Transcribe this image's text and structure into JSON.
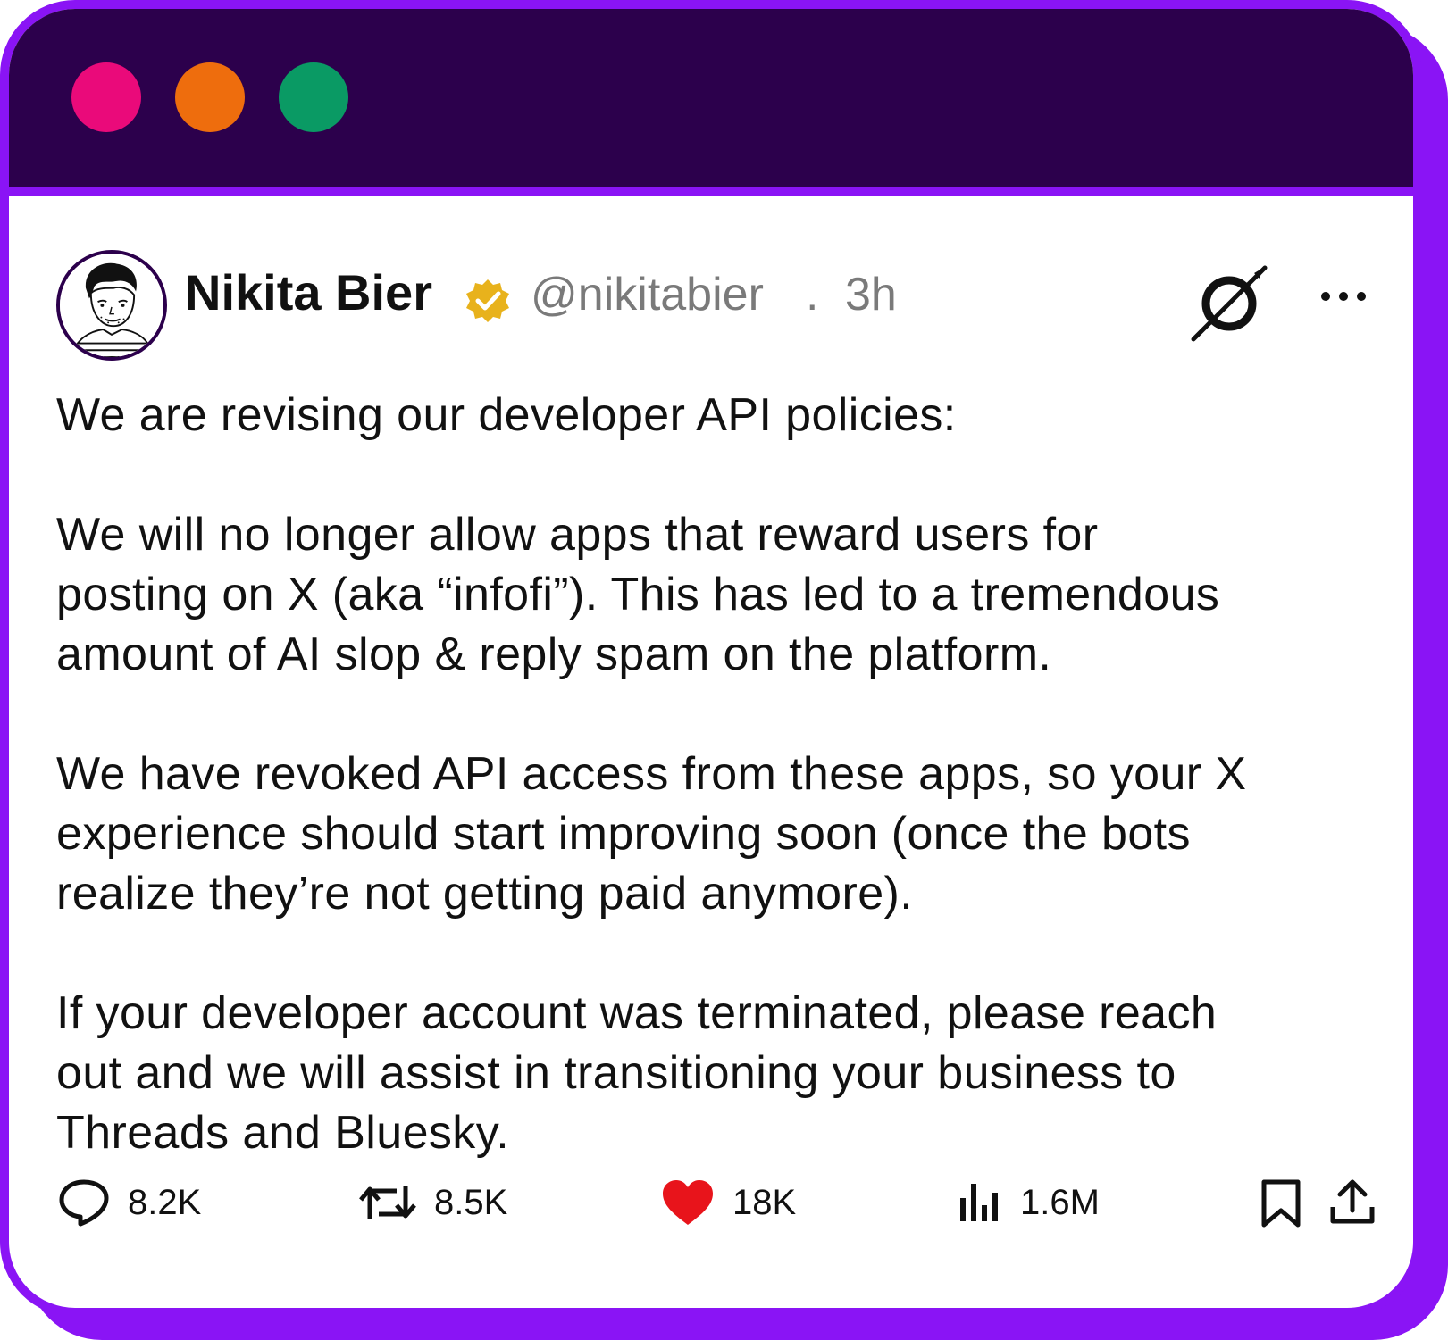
{
  "window": {
    "dots": [
      {
        "name": "close",
        "color": "#ea0a7a"
      },
      {
        "name": "minimize",
        "color": "#ee6d0d"
      },
      {
        "name": "maximize",
        "color": "#0a9a64"
      }
    ],
    "frame_color": "#8a14f5",
    "titlebar_color": "#2c004c"
  },
  "tweet": {
    "author_name": "Nikita Bier",
    "handle": "@nikitabier",
    "separator": ".",
    "time": "3h",
    "verified_badge_icon": "gold-verified-badge-icon",
    "paragraphs": [
      "We are revising our developer API policies:",
      "We will no longer allow apps that reward users for\nposting on X (aka “infofi”). This has led to a tremendous\namount of AI slop & reply spam on the platform.",
      "We have revoked API access from these apps, so your X\nexperience should start improving soon (once the bots\nrealize they’re not getting paid anymore).",
      "If your developer account was terminated, please reach\nout and we will assist in transitioning your business to\nThreads and Bluesky."
    ],
    "stats": {
      "replies": "8.2K",
      "reposts": "8.5K",
      "likes": "18K",
      "views": "1.6M"
    },
    "like_color": "#e8141b"
  }
}
